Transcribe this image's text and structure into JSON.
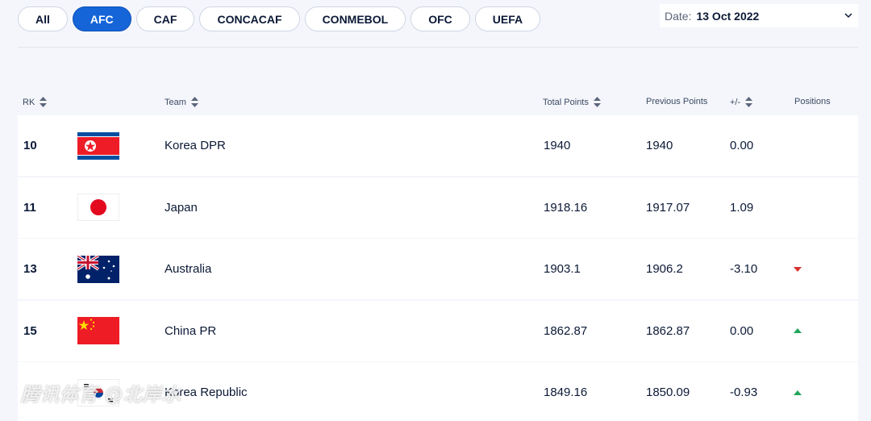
{
  "tabs": [
    "All",
    "AFC",
    "CAF",
    "CONCACAF",
    "CONMEBOL",
    "OFC",
    "UEFA"
  ],
  "active_tab": "AFC",
  "date_filter": {
    "label": "Date:",
    "value": "13 Oct 2022",
    "icon": "chevron-down-icon"
  },
  "table": {
    "headers": {
      "rk": "RK",
      "team": "Team",
      "total_points": "Total Points",
      "previous_points": "Previous Points",
      "plus_minus": "+/-",
      "positions": "Positions"
    },
    "rows": [
      {
        "rank": "10",
        "flag": "korea-dpr-flag",
        "team": "Korea DPR",
        "total_points": "1940",
        "previous_points": "1940",
        "diff": "0.00",
        "position_change": "none"
      },
      {
        "rank": "11",
        "flag": "japan-flag",
        "team": "Japan",
        "total_points": "1918.16",
        "previous_points": "1917.07",
        "diff": "1.09",
        "position_change": "none"
      },
      {
        "rank": "13",
        "flag": "australia-flag",
        "team": "Australia",
        "total_points": "1903.1",
        "previous_points": "1906.2",
        "diff": "-3.10",
        "position_change": "down"
      },
      {
        "rank": "15",
        "flag": "china-flag",
        "team": "China PR",
        "total_points": "1862.87",
        "previous_points": "1862.87",
        "diff": "0.00",
        "position_change": "up"
      },
      {
        "rank": "",
        "flag": "korea-republic-flag",
        "team": "Korea Republic",
        "total_points": "1849.16",
        "previous_points": "1850.09",
        "diff": "-0.93",
        "position_change": "up"
      }
    ]
  },
  "colors": {
    "accent": "#1565d8",
    "up": "#1ea65a",
    "down": "#d63230",
    "text": "#0b1936"
  },
  "watermark": "腾讯体育 @北岸水"
}
